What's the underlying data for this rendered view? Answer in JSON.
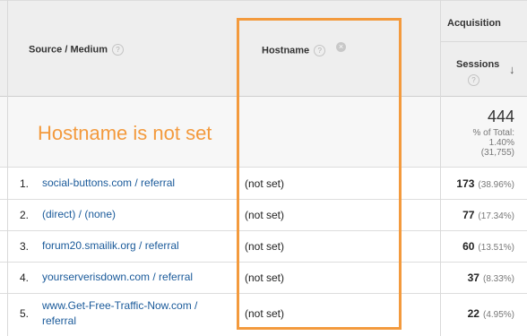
{
  "header": {
    "source_medium": "Source / Medium",
    "hostname": "Hostname",
    "acquisition": "Acquisition",
    "sessions": "Sessions",
    "help_glyph": "?",
    "remove_glyph": "×",
    "sort_glyph": "↓"
  },
  "annotation": {
    "text": "Hostname is not set",
    "color": "#f39a3d"
  },
  "totals": {
    "sessions": "444",
    "pct_label": "% of Total:",
    "pct_value": "1.40%",
    "overall": "(31,755)"
  },
  "rows": [
    {
      "num": "1.",
      "source": "social-buttons.com / referral",
      "host": "(not set)",
      "sessions": "173",
      "pct": "(38.96%)"
    },
    {
      "num": "2.",
      "source": "(direct) / (none)",
      "host": "(not set)",
      "sessions": "77",
      "pct": "(17.34%)"
    },
    {
      "num": "3.",
      "source": "forum20.smailik.org / referral",
      "host": "(not set)",
      "sessions": "60",
      "pct": "(13.51%)"
    },
    {
      "num": "4.",
      "source": "yourserverisdown.com / referral",
      "host": "(not set)",
      "sessions": "37",
      "pct": "(8.33%)"
    },
    {
      "num": "5.",
      "source_line1": "www.Get-Free-Traffic-Now.com /",
      "source_line2": "referral",
      "host": "(not set)",
      "sessions": "22",
      "pct": "(4.95%)"
    }
  ],
  "colors": {
    "link": "#1a5a9a",
    "highlight": "#f39a3d",
    "header_bg": "#eeeeee"
  }
}
